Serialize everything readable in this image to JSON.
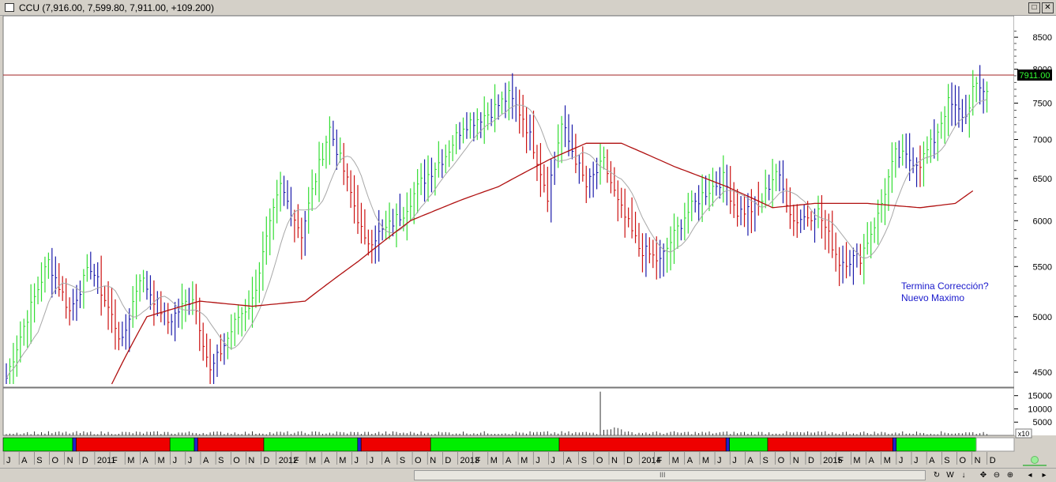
{
  "window": {
    "title": "CCU (7,916.00, 7,599.80, 7,911.00, +109.200)",
    "buttons": {
      "restore": "□",
      "close": "✕"
    }
  },
  "chart_data": [
    {
      "type": "bar",
      "subtype": "ohlc",
      "symbol": "CCU",
      "last_price_label": "7911.00",
      "resistance_level": 7911,
      "ylim": [
        4400,
        8800
      ],
      "y_scale": "log",
      "y_ticks": [
        "8500",
        "8000",
        "7500",
        "7000",
        "6500",
        "6000",
        "5500",
        "5000",
        "4500"
      ],
      "y_tick_values": [
        8500,
        8000,
        7500,
        7000,
        6500,
        6000,
        5500,
        5000,
        4500
      ],
      "annotation": [
        "Termina Corrección?",
        "Nuevo Maximo"
      ],
      "colors": {
        "up": "#33dd33",
        "down": "#cc1111",
        "neutral": "#1a1aaa",
        "ma_long": "#b01010",
        "ma_short": "#a8a8a8",
        "resistance": "#a02020"
      },
      "anchors": [
        [
          0,
          4450
        ],
        [
          6,
          5000
        ],
        [
          12,
          5550
        ],
        [
          18,
          5050
        ],
        [
          24,
          5500
        ],
        [
          33,
          4750
        ],
        [
          38,
          5400
        ],
        [
          46,
          4950
        ],
        [
          53,
          5200
        ],
        [
          58,
          4500
        ],
        [
          63,
          4800
        ],
        [
          66,
          5000
        ],
        [
          70,
          5150
        ],
        [
          78,
          6400
        ],
        [
          84,
          5850
        ],
        [
          92,
          7150
        ],
        [
          96,
          6600
        ],
        [
          102,
          5750
        ],
        [
          108,
          5900
        ],
        [
          113,
          6100
        ],
        [
          118,
          6450
        ],
        [
          125,
          6800
        ],
        [
          130,
          7200
        ],
        [
          137,
          7350
        ],
        [
          143,
          7600
        ],
        [
          147,
          7300
        ],
        [
          150,
          6900
        ],
        [
          154,
          6300
        ],
        [
          158,
          7200
        ],
        [
          165,
          6400
        ],
        [
          170,
          6700
        ],
        [
          174,
          6200
        ],
        [
          180,
          5700
        ],
        [
          186,
          5550
        ],
        [
          193,
          6050
        ],
        [
          198,
          6300
        ],
        [
          204,
          6500
        ],
        [
          208,
          6100
        ],
        [
          214,
          6150
        ],
        [
          219,
          6600
        ],
        [
          224,
          6000
        ],
        [
          231,
          6100
        ],
        [
          237,
          5550
        ],
        [
          243,
          5600
        ],
        [
          248,
          6050
        ],
        [
          253,
          6800
        ],
        [
          260,
          6700
        ],
        [
          264,
          7000
        ],
        [
          268,
          7500
        ],
        [
          273,
          7300
        ],
        [
          275,
          7700
        ]
      ],
      "ma_long_anchors": [
        [
          30,
          4400
        ],
        [
          40,
          5000
        ],
        [
          55,
          5150
        ],
        [
          70,
          5100
        ],
        [
          85,
          5150
        ],
        [
          100,
          5550
        ],
        [
          115,
          6000
        ],
        [
          130,
          6250
        ],
        [
          140,
          6400
        ],
        [
          155,
          6750
        ],
        [
          165,
          6950
        ],
        [
          175,
          6950
        ],
        [
          190,
          6650
        ],
        [
          205,
          6400
        ],
        [
          218,
          6150
        ],
        [
          230,
          6200
        ],
        [
          245,
          6200
        ],
        [
          260,
          6150
        ],
        [
          270,
          6200
        ],
        [
          275,
          6350
        ]
      ]
    },
    {
      "type": "bar",
      "series": "volume",
      "ylim": [
        0,
        17000
      ],
      "y_ticks": [
        "15000",
        "10000",
        "5000"
      ],
      "y_tick_values": [
        15000,
        10000,
        5000
      ],
      "unit_label": "x10",
      "spike": {
        "index": 169,
        "value": 16500
      }
    }
  ],
  "timeline": {
    "segments": [
      {
        "color": "green",
        "from": 0,
        "to": 20
      },
      {
        "color": "blue",
        "from": 20,
        "to": 21
      },
      {
        "color": "red",
        "from": 21,
        "to": 48
      },
      {
        "color": "green",
        "from": 48,
        "to": 55
      },
      {
        "color": "blue",
        "from": 55,
        "to": 56
      },
      {
        "color": "red",
        "from": 56,
        "to": 75
      },
      {
        "color": "green",
        "from": 75,
        "to": 102
      },
      {
        "color": "blue",
        "from": 102,
        "to": 103
      },
      {
        "color": "red",
        "from": 103,
        "to": 123
      },
      {
        "color": "green",
        "from": 123,
        "to": 160
      },
      {
        "color": "red",
        "from": 160,
        "to": 208
      },
      {
        "color": "blue",
        "from": 208,
        "to": 209
      },
      {
        "color": "green",
        "from": 209,
        "to": 220
      },
      {
        "color": "red",
        "from": 220,
        "to": 256
      },
      {
        "color": "blue",
        "from": 256,
        "to": 257
      },
      {
        "color": "green",
        "from": 257,
        "to": 280
      }
    ],
    "months": [
      "J",
      "A",
      "S",
      "O",
      "N",
      "D",
      "2011",
      "F",
      "M",
      "A",
      "M",
      "J",
      "J",
      "A",
      "S",
      "O",
      "N",
      "D",
      "2012",
      "F",
      "M",
      "A",
      "M",
      "J",
      "J",
      "A",
      "S",
      "O",
      "N",
      "D",
      "2013",
      "F",
      "M",
      "A",
      "M",
      "J",
      "J",
      "A",
      "S",
      "O",
      "N",
      "D",
      "2014",
      "F",
      "M",
      "A",
      "M",
      "J",
      "J",
      "A",
      "S",
      "O",
      "N",
      "D",
      "2015",
      "F",
      "M",
      "A",
      "M",
      "J",
      "J",
      "A",
      "S",
      "O",
      "N",
      "D"
    ]
  },
  "statusbar": {
    "grip": "III",
    "buttons": [
      "↻",
      "W",
      "↓",
      "✥",
      "⊖",
      "⊕",
      "◂",
      "▸"
    ]
  }
}
